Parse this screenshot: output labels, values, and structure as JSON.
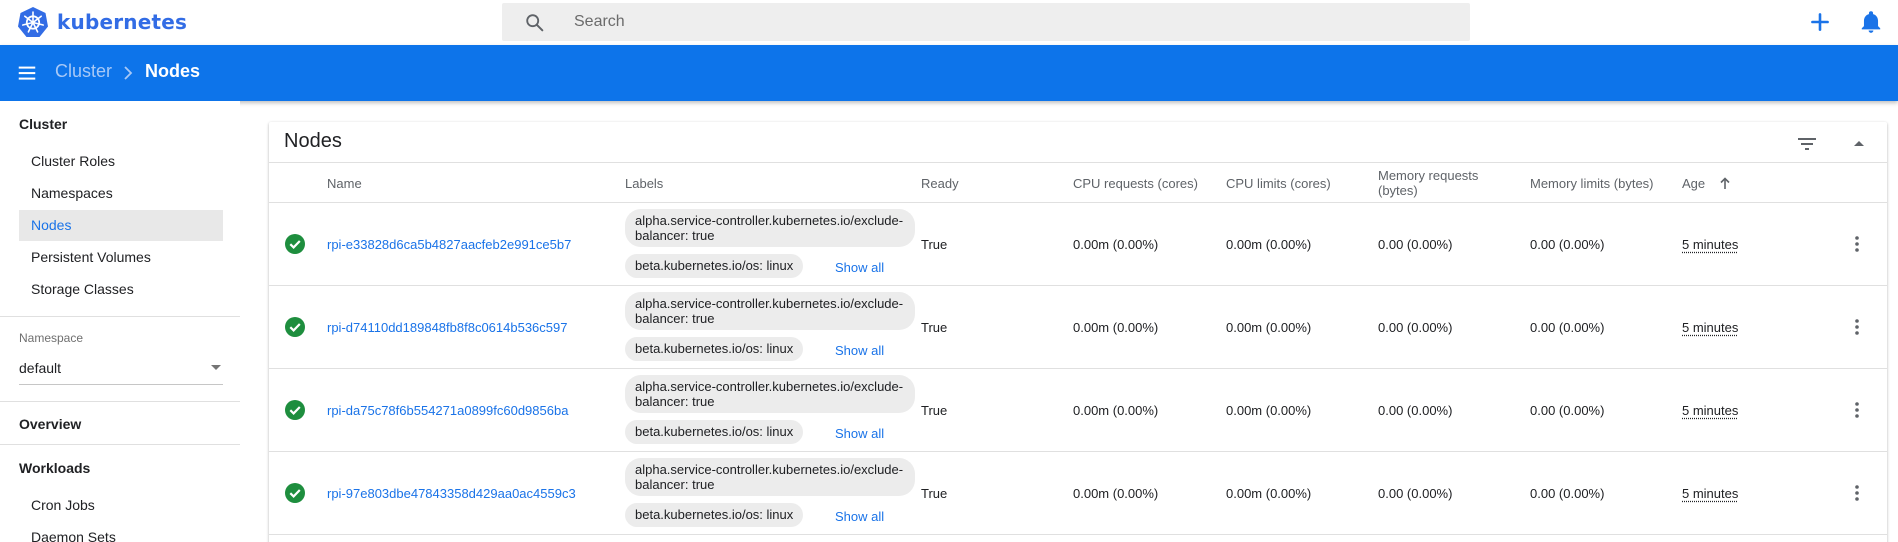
{
  "app": {
    "name": "kubernetes"
  },
  "search": {
    "placeholder": "Search"
  },
  "breadcrumb": {
    "parent": "Cluster",
    "current": "Nodes"
  },
  "sidebar": {
    "cluster_heading": "Cluster",
    "cluster_items": [
      {
        "label": "Cluster Roles",
        "active": false
      },
      {
        "label": "Namespaces",
        "active": false
      },
      {
        "label": "Nodes",
        "active": true
      },
      {
        "label": "Persistent Volumes",
        "active": false
      },
      {
        "label": "Storage Classes",
        "active": false
      }
    ],
    "namespace_label": "Namespace",
    "namespace_value": "default",
    "overview_label": "Overview",
    "workloads_heading": "Workloads",
    "workload_items": [
      {
        "label": "Cron Jobs"
      },
      {
        "label": "Daemon Sets"
      }
    ]
  },
  "card": {
    "title": "Nodes",
    "columns": {
      "name": "Name",
      "labels": "Labels",
      "ready": "Ready",
      "cpu_requests": "CPU requests (cores)",
      "cpu_limits": "CPU limits (cores)",
      "memory_requests": "Memory requests (bytes)",
      "memory_limits": "Memory limits (bytes)",
      "age": "Age"
    },
    "show_all_label": "Show all",
    "rows": [
      {
        "name": "rpi-e33828d6ca5b4827aacfeb2e991ce5b7",
        "label1": "alpha.service-controller.kubernetes.io/exclude-balancer: true",
        "label2": "beta.kubernetes.io/os: linux",
        "ready": "True",
        "cpu_requests": "0.00m (0.00%)",
        "cpu_limits": "0.00m (0.00%)",
        "memory_requests": "0.00 (0.00%)",
        "memory_limits": "0.00 (0.00%)",
        "age": "5 minutes"
      },
      {
        "name": "rpi-d74110dd189848fb8f8c0614b536c597",
        "label1": "alpha.service-controller.kubernetes.io/exclude-balancer: true",
        "label2": "beta.kubernetes.io/os: linux",
        "ready": "True",
        "cpu_requests": "0.00m (0.00%)",
        "cpu_limits": "0.00m (0.00%)",
        "memory_requests": "0.00 (0.00%)",
        "memory_limits": "0.00 (0.00%)",
        "age": "5 minutes"
      },
      {
        "name": "rpi-da75c78f6b554271a0899fc60d9856ba",
        "label1": "alpha.service-controller.kubernetes.io/exclude-balancer: true",
        "label2": "beta.kubernetes.io/os: linux",
        "ready": "True",
        "cpu_requests": "0.00m (0.00%)",
        "cpu_limits": "0.00m (0.00%)",
        "memory_requests": "0.00 (0.00%)",
        "memory_limits": "0.00 (0.00%)",
        "age": "5 minutes"
      },
      {
        "name": "rpi-97e803dbe47843358d429aa0ac4559c3",
        "label1": "alpha.service-controller.kubernetes.io/exclude-balancer: true",
        "label2": "beta.kubernetes.io/os: linux",
        "ready": "True",
        "cpu_requests": "0.00m (0.00%)",
        "cpu_limits": "0.00m (0.00%)",
        "memory_requests": "0.00 (0.00%)",
        "memory_limits": "0.00 (0.00%)",
        "age": "5 minutes"
      }
    ]
  },
  "colors": {
    "brand": "#326ce5",
    "toolbar": "#0d74ea",
    "link": "#1a73e8",
    "status_ok": "#1e8e3e"
  }
}
